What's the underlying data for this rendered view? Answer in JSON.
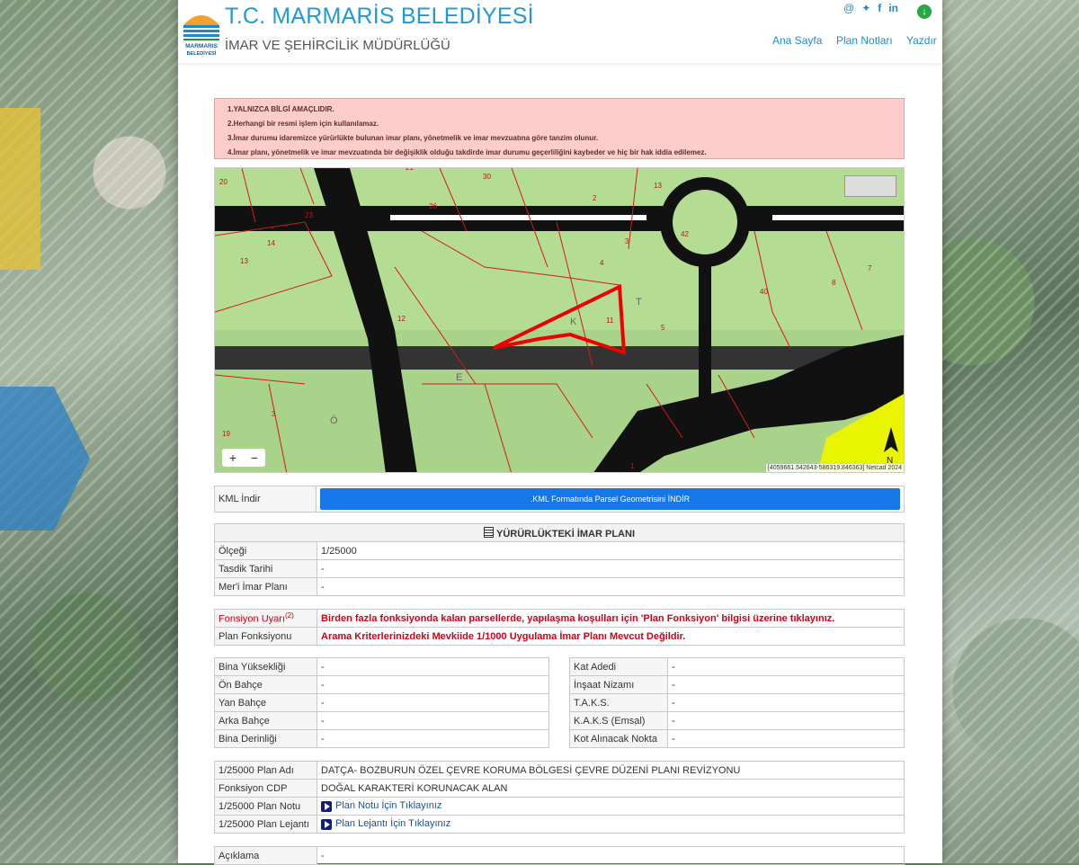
{
  "header": {
    "logo_text": "MARMARIS BELEDİYESİ",
    "title": "T.C. MARMARİS BELEDİYESİ",
    "subtitle": "İMAR VE ŞEHİRCİLİK MÜDÜRLÜĞÜ",
    "nav": [
      "Ana Sayfa",
      "Plan Notları",
      "Yazdır"
    ],
    "social_icons": [
      "at-icon",
      "twitter-icon",
      "facebook-icon",
      "linkedin-icon"
    ],
    "download_icon": "download-icon"
  },
  "warnings": [
    "1.YALNIZCA BİLGİ AMAÇLIDIR.",
    "2.Herhangi bir resmi işlem için kullanılamaz.",
    "3.İmar durumu idaremizce yürürlükte bulunan imar planı, yönetmelik ve imar mevzuatına göre tanzim olunur.",
    "4.İmar planı, yönetmelik ve imar mevzuatında bir değişiklik olduğu takdirde imar durumu geçerliliğini kaybeder ve hiç bir hak iddia edilemez."
  ],
  "map": {
    "parcel_numbers": [
      "20",
      "21",
      "30",
      "2",
      "13",
      "23",
      "26",
      "42",
      "14",
      "13",
      "3",
      "4",
      "40",
      "7",
      "8",
      "12",
      "11",
      "5",
      "3",
      "19",
      "1"
    ],
    "street_letters": [
      "T",
      "K",
      "E",
      "Ö"
    ],
    "zoom_in": "+",
    "zoom_out": "−",
    "attribution": "[4059661.542643-586319.846363] Netcad 2024",
    "north_label": "N"
  },
  "kml": {
    "label": "KML İndir",
    "button": ".KML Formatında Parsel Geometrisini İNDİR"
  },
  "plan_section": {
    "heading": "YÜRÜRLÜKTEKİ İMAR PLANI",
    "rows": [
      {
        "label": "Ölçeği",
        "value": "1/25000"
      },
      {
        "label": "Tasdik Tarihi",
        "value": "-"
      },
      {
        "label": "Mer'i İmar Planı",
        "value": "-"
      }
    ]
  },
  "function": {
    "warning_label": "Fonsiyon Uyarı",
    "warning_sup": "(2)",
    "warning_text": "Birden fazla fonksiyonda kalan parsellerde, yapılaşma koşulları için 'Plan Fonksiyon' bilgisi üzerine tıklayınız.",
    "plan_label": "Plan Fonksiyonu",
    "plan_text": "Arama Kriterlerinizdeki Mevkiide 1/1000 Uygulama İmar Planı Mevcut Değildir."
  },
  "building_left": [
    {
      "label": "Bina Yüksekliği",
      "value": "-"
    },
    {
      "label": "Ön Bahçe",
      "value": "-"
    },
    {
      "label": "Yan Bahçe",
      "value": "-"
    },
    {
      "label": "Arka Bahçe",
      "value": "-"
    },
    {
      "label": "Bina Derinliği",
      "value": "-"
    }
  ],
  "building_right": [
    {
      "label": "Kat Adedi",
      "value": "-"
    },
    {
      "label": "İnşaat Nizamı",
      "value": "-"
    },
    {
      "label": "T.A.K.S.",
      "value": "-"
    },
    {
      "label": "K.A.K.S (Emsal)",
      "value": "-"
    },
    {
      "label": "Kot Alınacak Nokta",
      "value": "-"
    }
  ],
  "plan25000": {
    "name_label": "1/25000 Plan Adı",
    "name_value": "DATÇA- BOZBURUN ÖZEL ÇEVRE KORUMA BÖLGESİ ÇEVRE DÜZENİ PLANI REVİZYONU",
    "cdp_label": "Fonksiyon CDP",
    "cdp_value": "DOĞAL KARAKTERİ KORUNACAK ALAN",
    "note_label": "1/25000 Plan Notu",
    "note_link": "Plan Notu İçin Tıklayınız",
    "legend_label": "1/25000 Plan Lejantı",
    "legend_link": "Plan Lejantı İçin Tıklayınız"
  },
  "description": {
    "label": "Açıklama",
    "value": "-"
  }
}
